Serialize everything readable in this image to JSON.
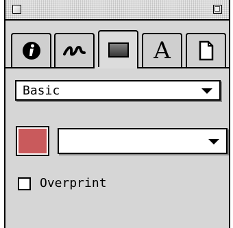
{
  "window": {
    "close_icon": "close-box-icon",
    "zoom_icon": "zoom-box-icon"
  },
  "tabs": [
    {
      "icon": "info-icon"
    },
    {
      "icon": "stroke-icon"
    },
    {
      "icon": "fill-icon",
      "active": true
    },
    {
      "icon": "text-icon",
      "glyph": "A"
    },
    {
      "icon": "document-icon"
    }
  ],
  "fill": {
    "type_value": "Basic",
    "swatch_color": "#c95a5c",
    "color_value": ""
  },
  "overprint": {
    "label": "Overprint",
    "checked": false
  }
}
